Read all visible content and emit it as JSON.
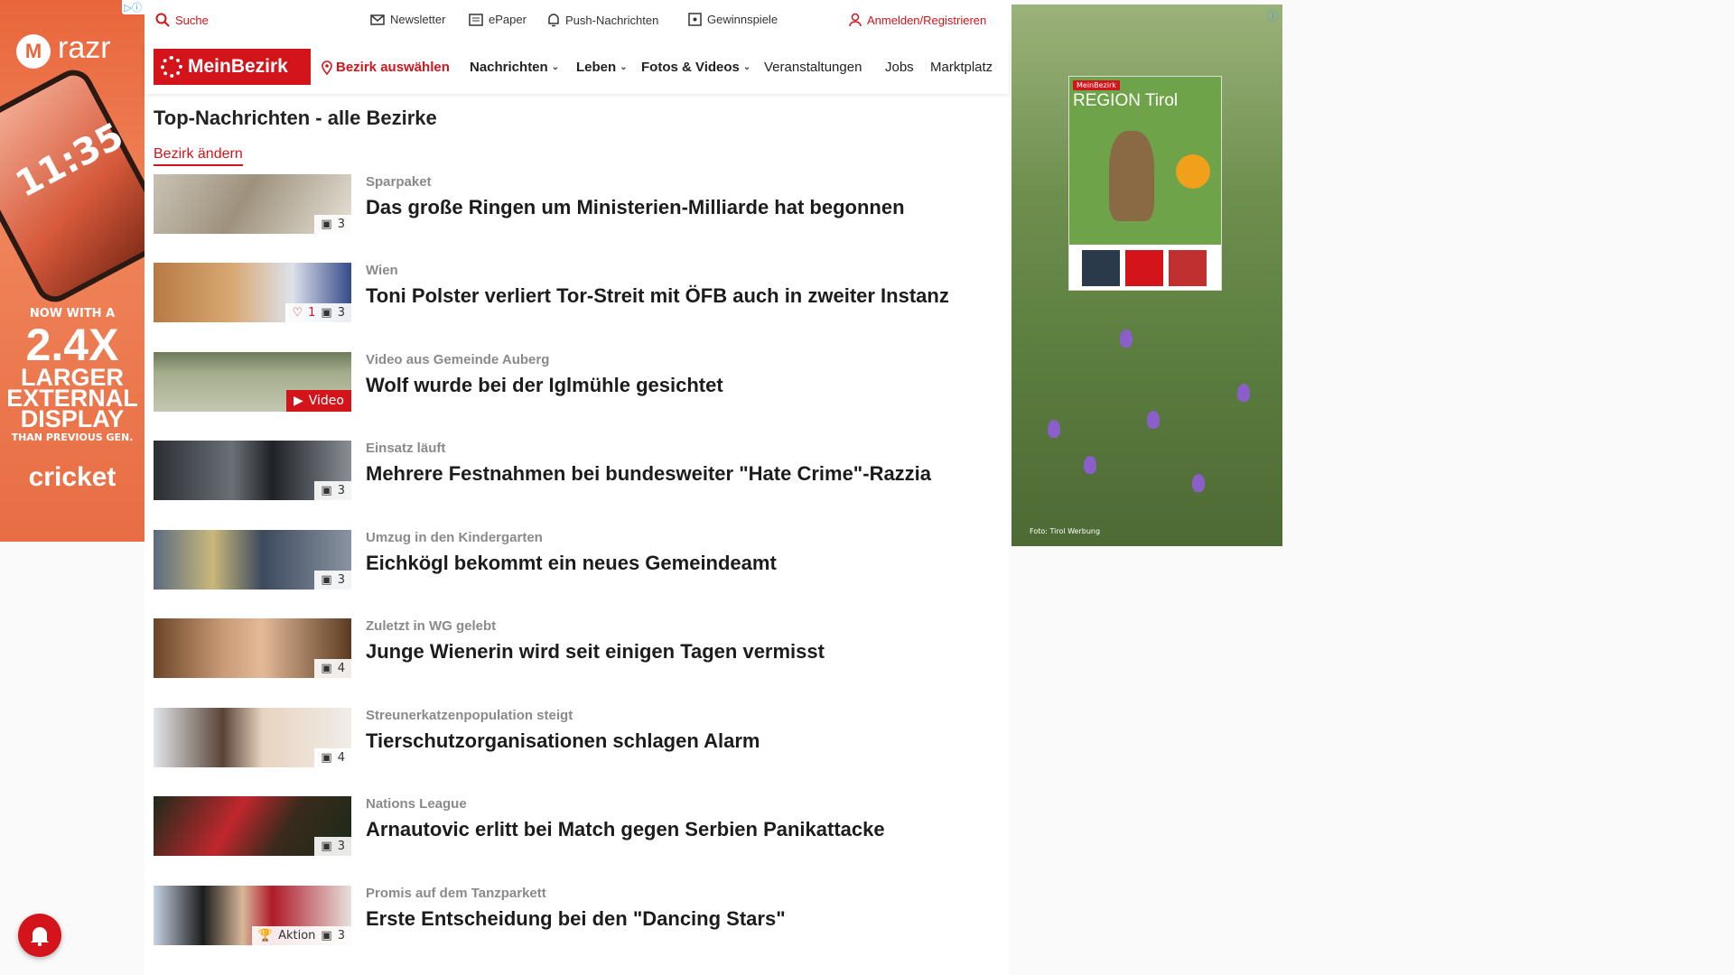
{
  "left_ad": {
    "badge": "▷ⓘ",
    "brand": "razr",
    "phone_time": "11:35",
    "tagline_top": "NOW WITH A",
    "tagline_big": "2.4X",
    "tagline_l1": "LARGER",
    "tagline_l2": "EXTERNAL",
    "tagline_l3": "DISPLAY",
    "tagline_small": "THAN PREVIOUS GEN.",
    "carrier": "cricket"
  },
  "topbar": {
    "search": "Suche",
    "newsletter": "Newsletter",
    "epaper": "ePaper",
    "push": "Push-Nachrichten",
    "gewinnspiele": "Gewinnspiele",
    "login": "Anmelden/Registrieren"
  },
  "nav": {
    "logo": "MeinBezirk",
    "bezirk": "Bezirk auswählen",
    "items": [
      "Nachrichten",
      "Leben",
      "Fotos & Videos",
      "Veranstaltungen",
      "Jobs",
      "Marktplatz"
    ]
  },
  "page": {
    "title": "Top-Nachrichten - alle Bezirke",
    "change_link": "Bezirk ändern"
  },
  "articles": [
    {
      "kicker": "Sparpaket",
      "headline": "Das große Ringen um Ministerien-Milliarde hat begonnen",
      "photos": "3",
      "likes": "",
      "badge": ""
    },
    {
      "kicker": "Wien",
      "headline": "Toni Polster verliert Tor-Streit mit ÖFB auch in zweiter Instanz",
      "photos": "3",
      "likes": "1",
      "badge": ""
    },
    {
      "kicker": "Video aus Gemeinde Auberg",
      "headline": "Wolf wurde bei der Iglmühle gesichtet",
      "photos": "",
      "likes": "",
      "badge": "Video"
    },
    {
      "kicker": "Einsatz läuft",
      "headline": "Mehrere Festnahmen bei bundesweiter \"Hate Crime\"-Razzia",
      "photos": "3",
      "likes": "",
      "badge": ""
    },
    {
      "kicker": "Umzug in den Kindergarten",
      "headline": "Eichkögl bekommt ein neues Gemeindeamt",
      "photos": "3",
      "likes": "",
      "badge": ""
    },
    {
      "kicker": "Zuletzt in WG gelebt",
      "headline": "Junge Wienerin wird seit einigen Tagen vermisst",
      "photos": "4",
      "likes": "",
      "badge": ""
    },
    {
      "kicker": "Streunerkatzenpopulation steigt",
      "headline": "Tierschutzorganisationen schlagen Alarm",
      "photos": "4",
      "likes": "",
      "badge": ""
    },
    {
      "kicker": "Nations League",
      "headline": "Arnautovic erlitt bei Match gegen Serbien Panikattacke",
      "photos": "3",
      "likes": "",
      "badge": ""
    },
    {
      "kicker": "Promis auf dem Tanzparkett",
      "headline": "Erste Entscheidung bei den \"Dancing Stars\"",
      "photos": "3",
      "likes": "",
      "badge": "Aktion"
    }
  ],
  "right_ad": {
    "info": "ⓘ",
    "magazine_logo": "MeinBezirk",
    "magazine_title": "REGION Tirol",
    "photo_credit": "Foto: Tirol Werbung"
  },
  "colors": {
    "brand_red": "#d4141b"
  }
}
